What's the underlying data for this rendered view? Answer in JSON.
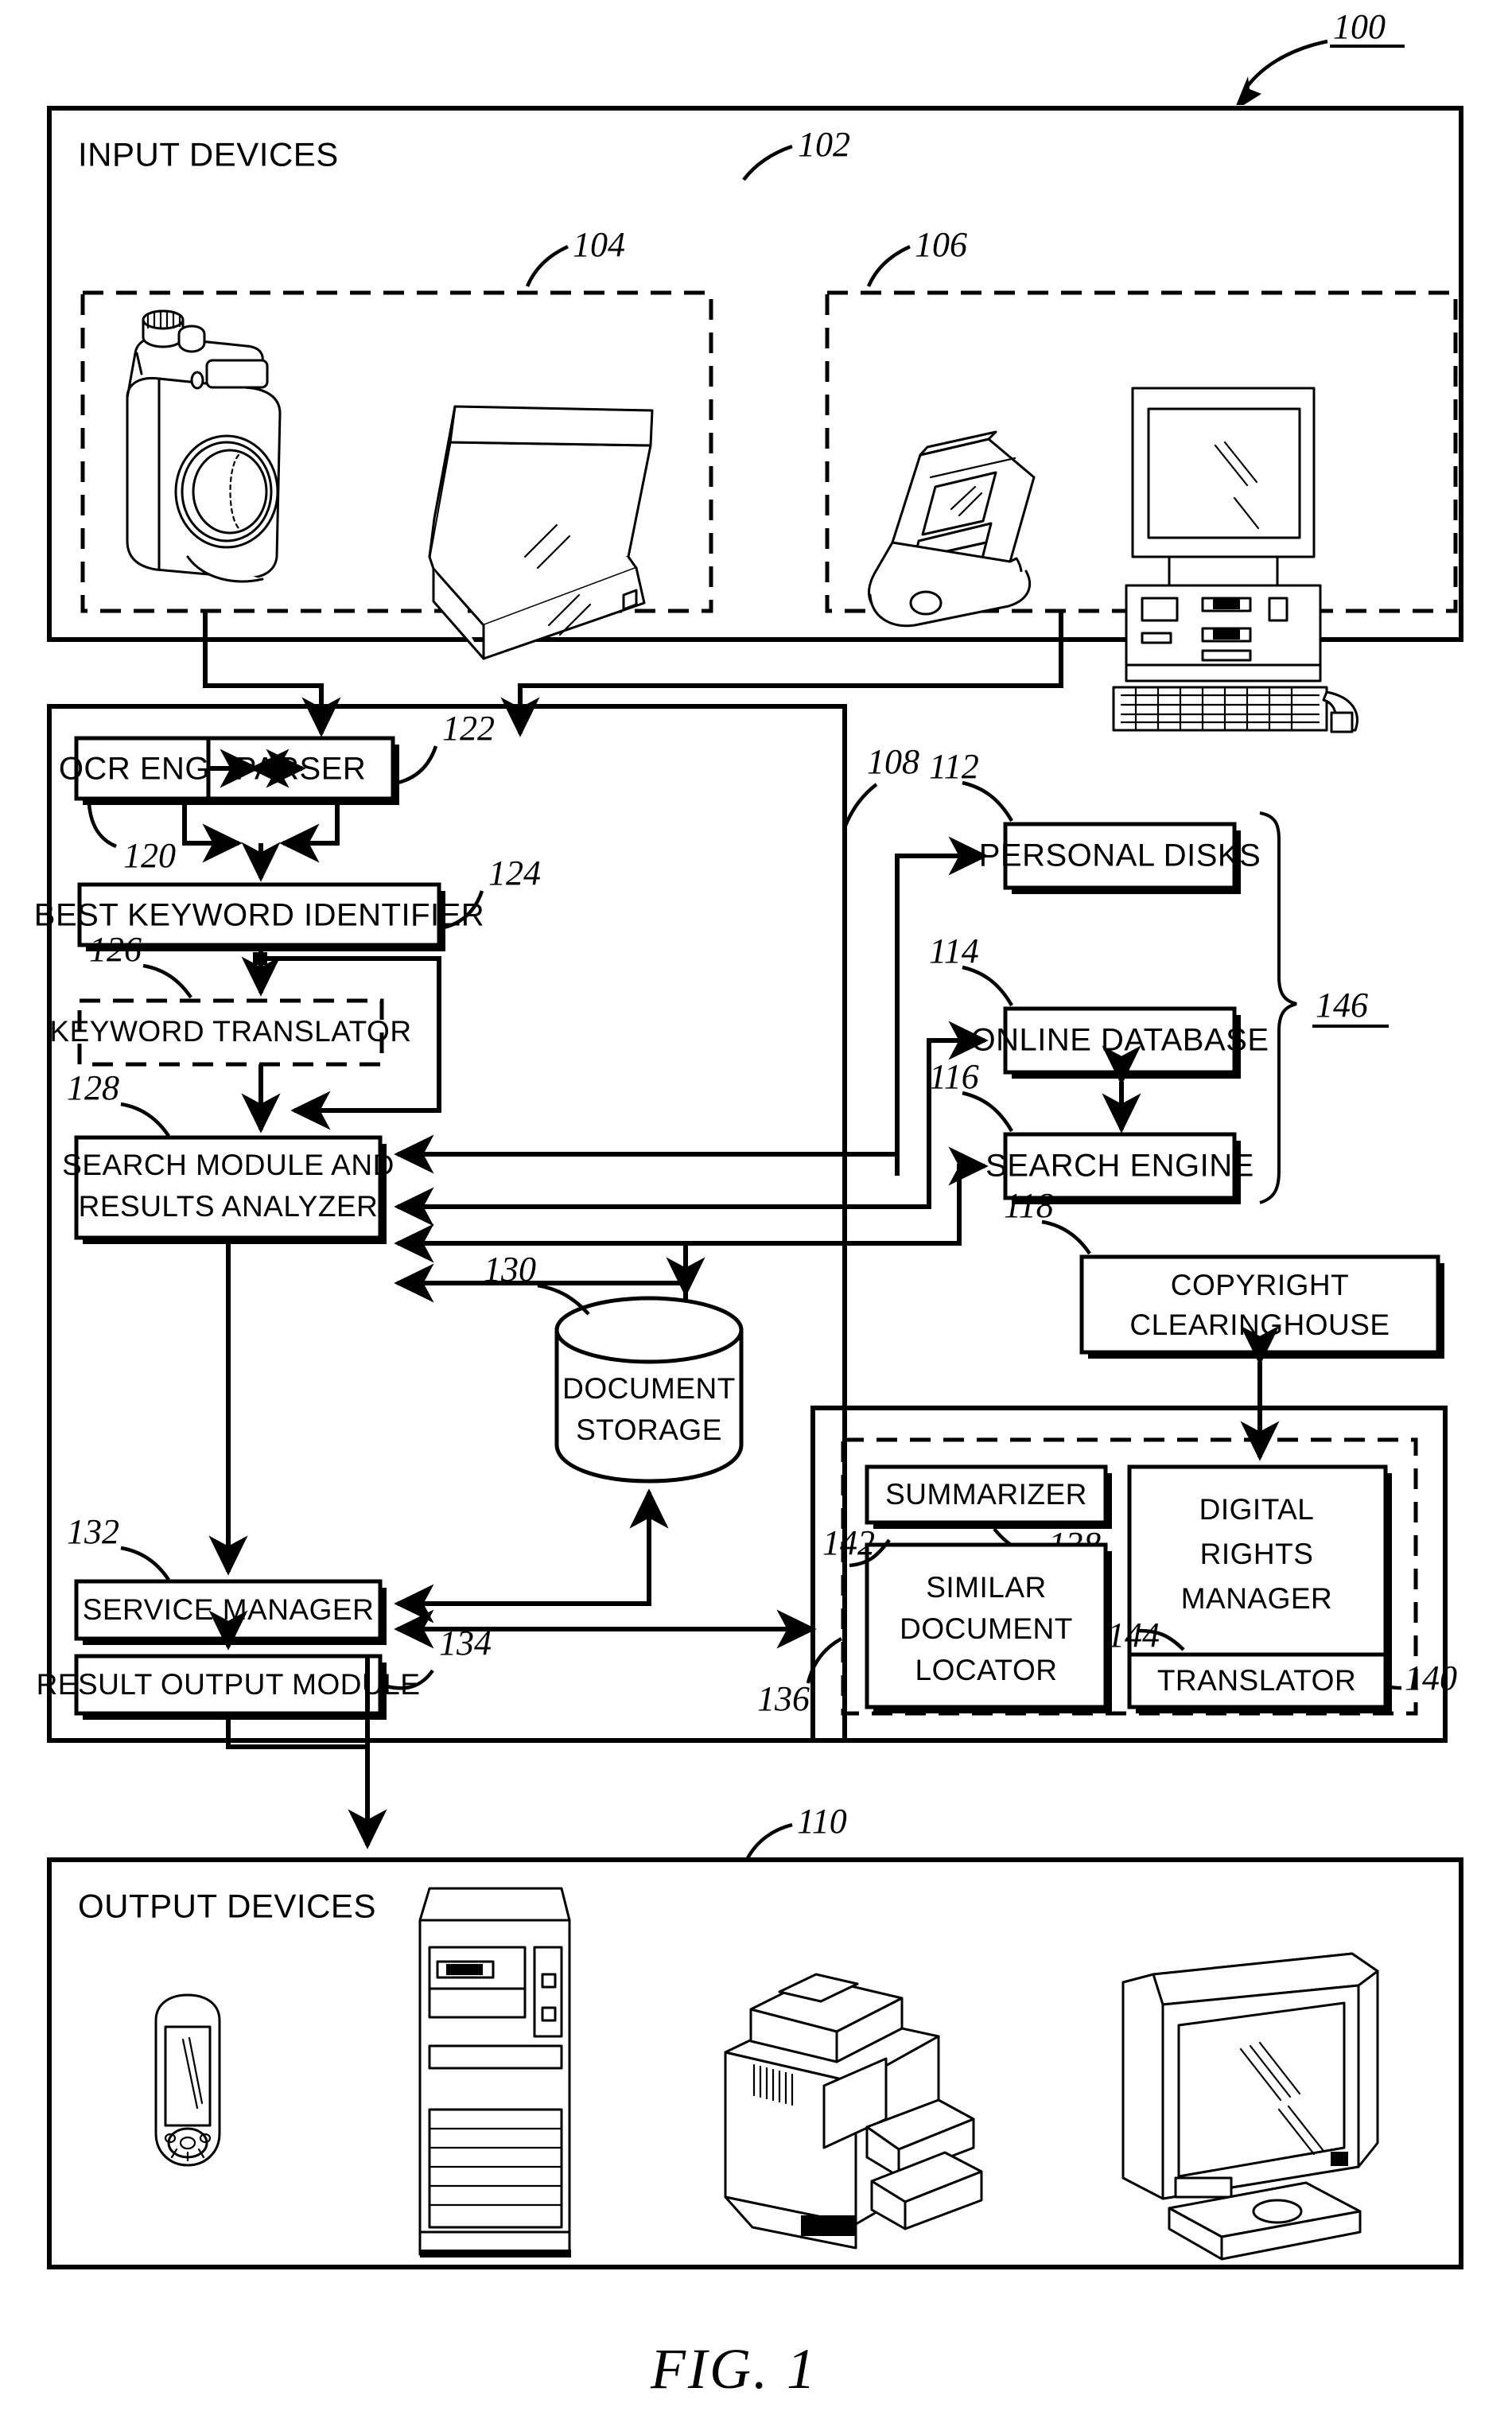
{
  "figure": {
    "caption": "FIG. 1",
    "system_ref": "100"
  },
  "input_section": {
    "title": "INPUT DEVICES",
    "ref": "102",
    "groups": [
      {
        "ref": "104",
        "devices": [
          "digital-camera",
          "flatbed-scanner"
        ]
      },
      {
        "ref": "106",
        "devices": [
          "pda-cradle",
          "desktop-computer"
        ]
      }
    ]
  },
  "processing_section": {
    "ref": "108",
    "blocks": [
      {
        "ref": "120",
        "label": "OCR ENGINE"
      },
      {
        "ref": "122",
        "label": "PARSER"
      },
      {
        "ref": "124",
        "label": "BEST KEYWORD IDENTIFIER"
      },
      {
        "ref": "126",
        "label": "KEYWORD TRANSLATOR",
        "style": "dashed"
      },
      {
        "ref": "128",
        "label_line1": "SEARCH MODULE AND",
        "label_line2": "RESULTS ANALYZER"
      },
      {
        "ref": "130",
        "label_line1": "DOCUMENT",
        "label_line2": "STORAGE",
        "style": "cylinder"
      },
      {
        "ref": "132",
        "label": "SERVICE MANAGER"
      },
      {
        "ref": "134",
        "label": "RESULT OUTPUT MODULE"
      }
    ]
  },
  "external_sources": {
    "group_ref": "146",
    "blocks": [
      {
        "ref": "112",
        "label": "PERSONAL DISKS"
      },
      {
        "ref": "114",
        "label": "ONLINE DATABASE"
      },
      {
        "ref": "116",
        "label": "SEARCH ENGINE"
      }
    ]
  },
  "copyright_block": {
    "ref": "118",
    "label_line1": "COPYRIGHT",
    "label_line2": "CLEARINGHOUSE"
  },
  "services_section": {
    "ref": "136",
    "style": "dashed",
    "blocks": [
      {
        "ref": "138",
        "label": "SUMMARIZER"
      },
      {
        "ref": "140",
        "label_line1": "DIGITAL",
        "label_line2": "RIGHTS",
        "label_line3": "MANAGER"
      },
      {
        "ref": "142",
        "label_line1": "SIMILAR",
        "label_line2": "DOCUMENT",
        "label_line3": "LOCATOR"
      },
      {
        "ref": "144",
        "label": "TRANSLATOR"
      }
    ]
  },
  "output_section": {
    "title": "OUTPUT DEVICES",
    "ref": "110",
    "devices": [
      "pda-handheld",
      "tower-computer",
      "printer-copier",
      "crt-monitor"
    ]
  },
  "colors": {
    "ink": "#000000",
    "paper": "#ffffff"
  }
}
